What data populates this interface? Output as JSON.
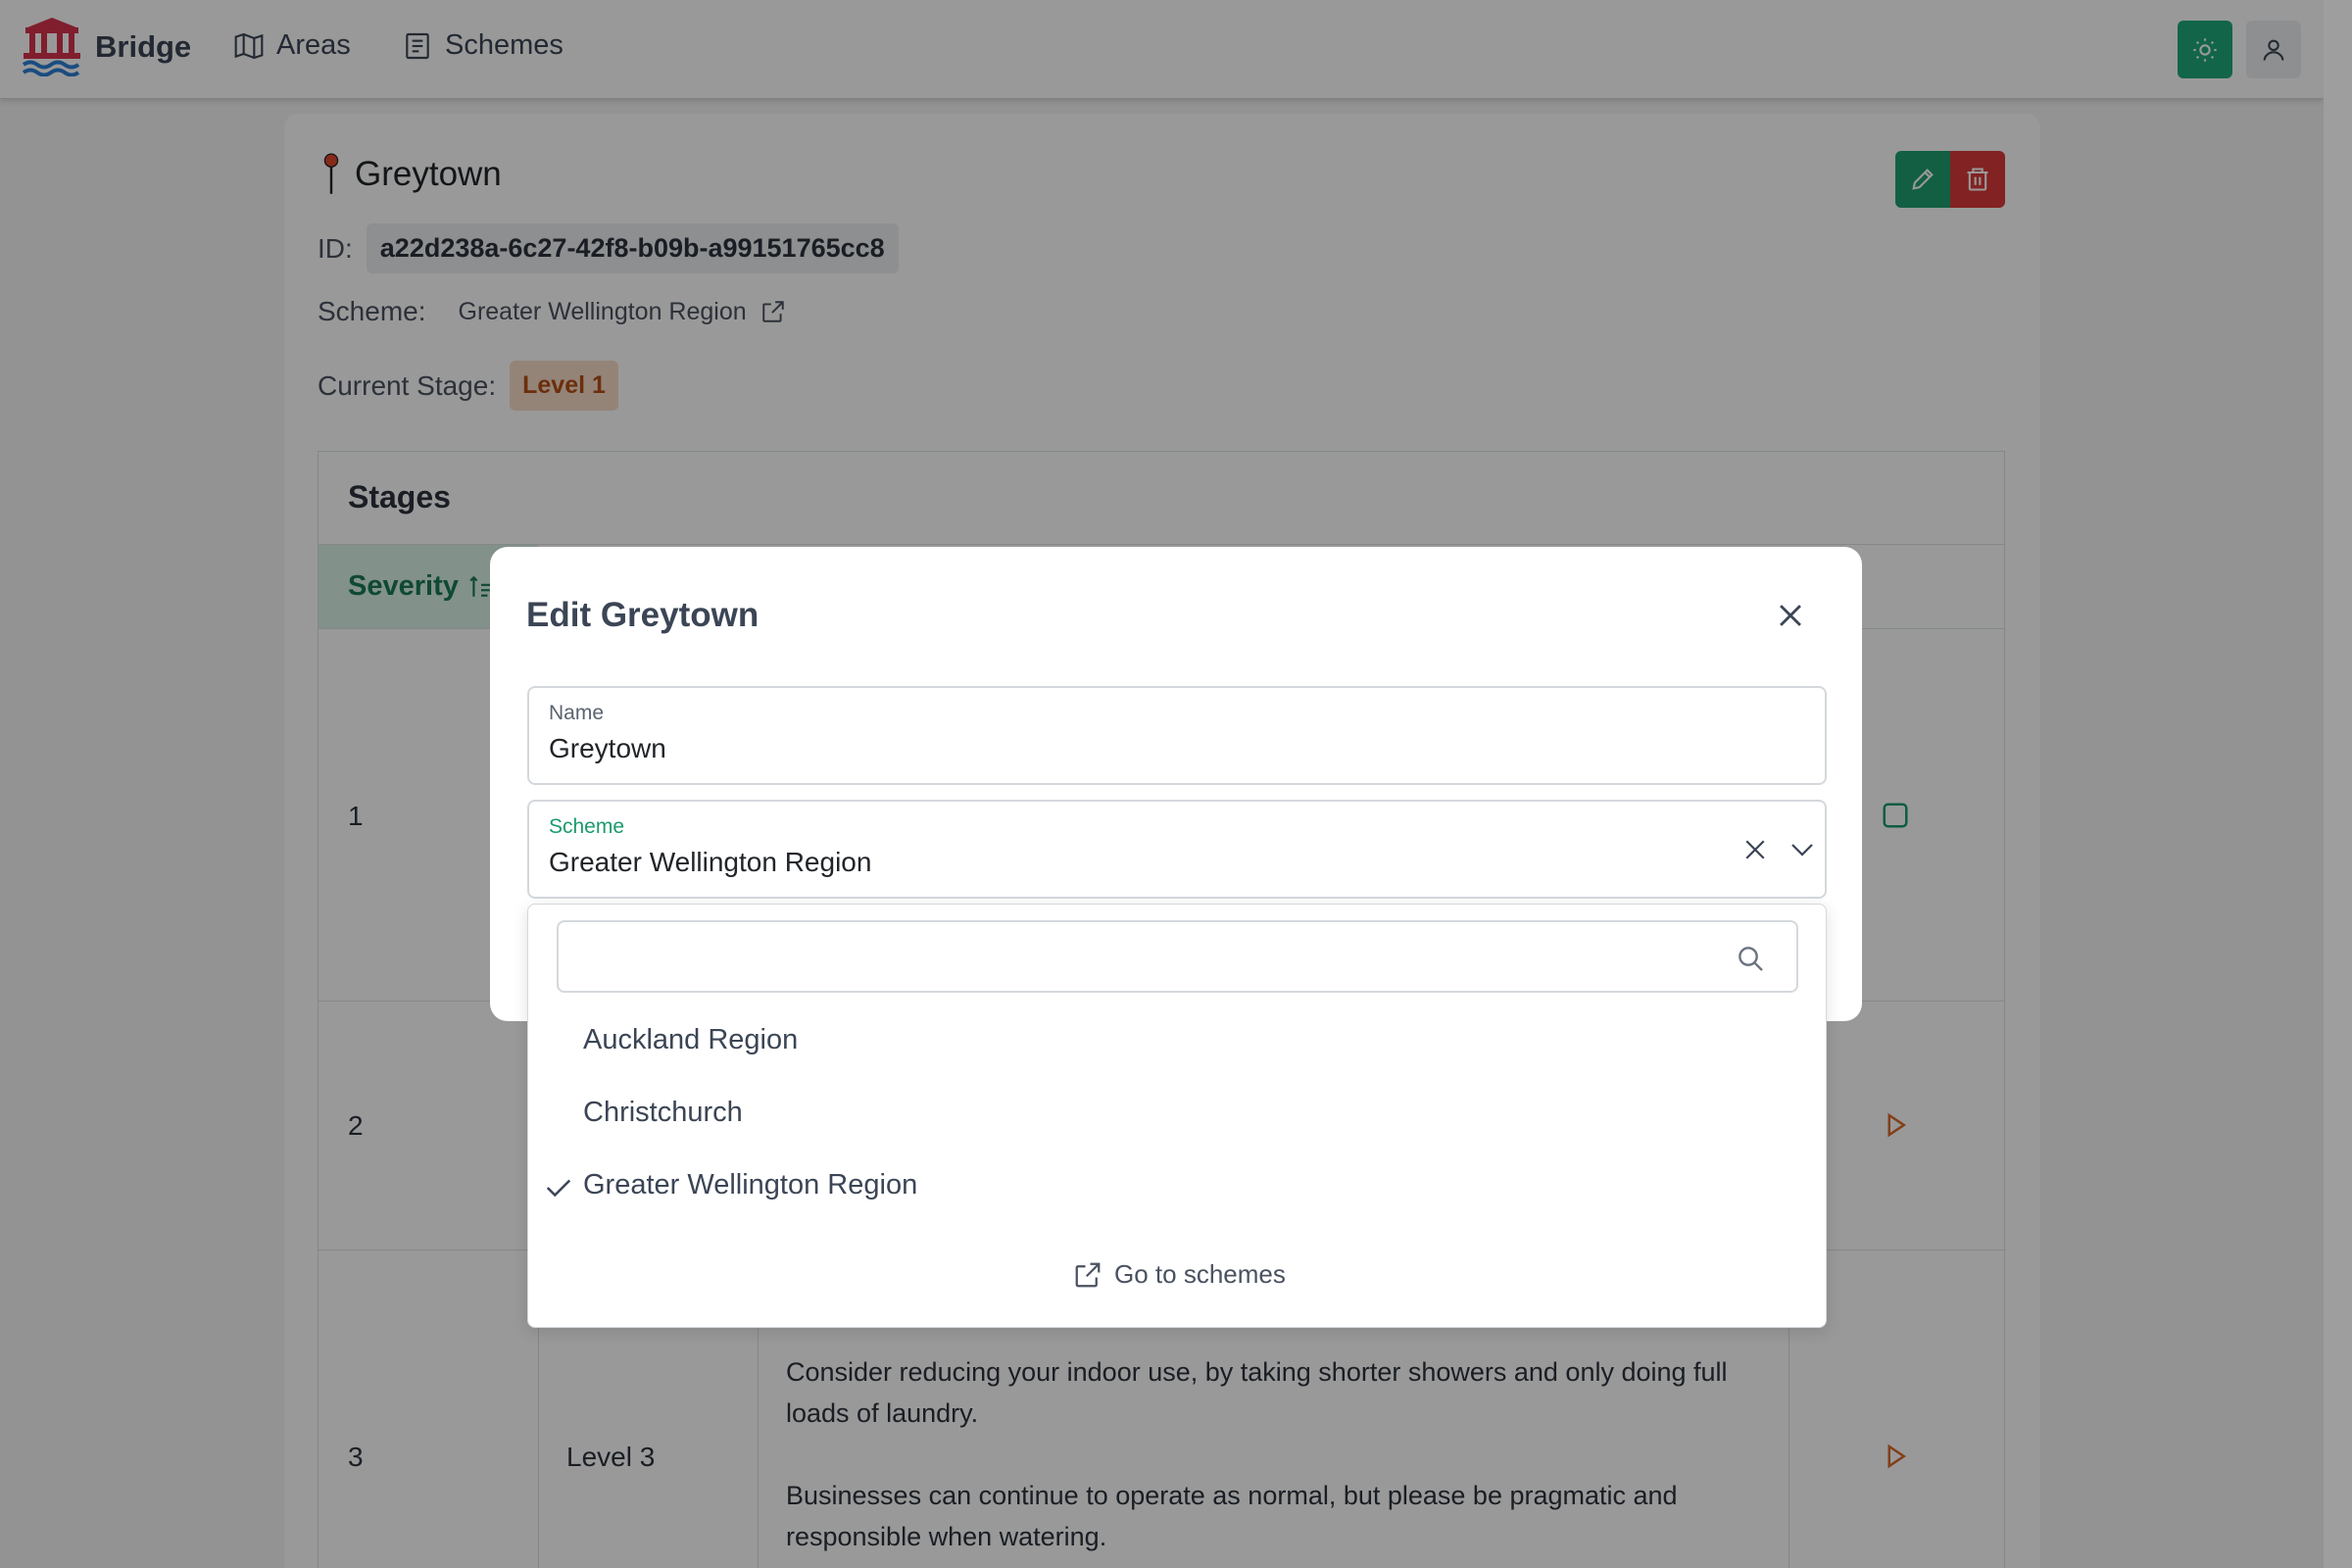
{
  "navbar": {
    "brand": "Bridge",
    "links": [
      {
        "label": "Areas",
        "icon": "map-icon"
      },
      {
        "label": "Schemes",
        "icon": "document-list-icon"
      }
    ]
  },
  "area": {
    "title": "Greytown",
    "id_label": "ID:",
    "id_value": "a22d238a-6c27-42f8-b09b-a99151765cc8",
    "scheme_label": "Scheme:",
    "scheme_value": "Greater Wellington Region",
    "stage_label": "Current Stage:",
    "stage_value": "Level 1"
  },
  "stages": {
    "title": "Stages",
    "severity_header": "Severity",
    "rows": [
      {
        "severity": "1",
        "name": "",
        "description": []
      },
      {
        "severity": "2",
        "name": "",
        "description": []
      },
      {
        "severity": "3",
        "name": "Level 3",
        "description": [
          "Consider reducing your indoor use, by taking shorter showers and only doing full loads of laundry.",
          "Businesses can continue to operate as normal, but please be pragmatic and responsible when watering."
        ]
      }
    ]
  },
  "modal": {
    "title": "Edit Greytown",
    "name_label": "Name",
    "name_value": "Greytown",
    "scheme_label": "Scheme",
    "scheme_value": "Greater Wellington Region"
  },
  "dropdown": {
    "search_value": "",
    "options": [
      {
        "label": "Auckland Region",
        "selected": false
      },
      {
        "label": "Christchurch",
        "selected": false
      },
      {
        "label": "Greater Wellington Region",
        "selected": true
      }
    ],
    "footer_link": "Go to schemes"
  },
  "colors": {
    "primary": "#1fa97a",
    "danger": "#d93a3a",
    "warning_text": "#b44e14",
    "warning_bg": "#f7dcc9"
  }
}
